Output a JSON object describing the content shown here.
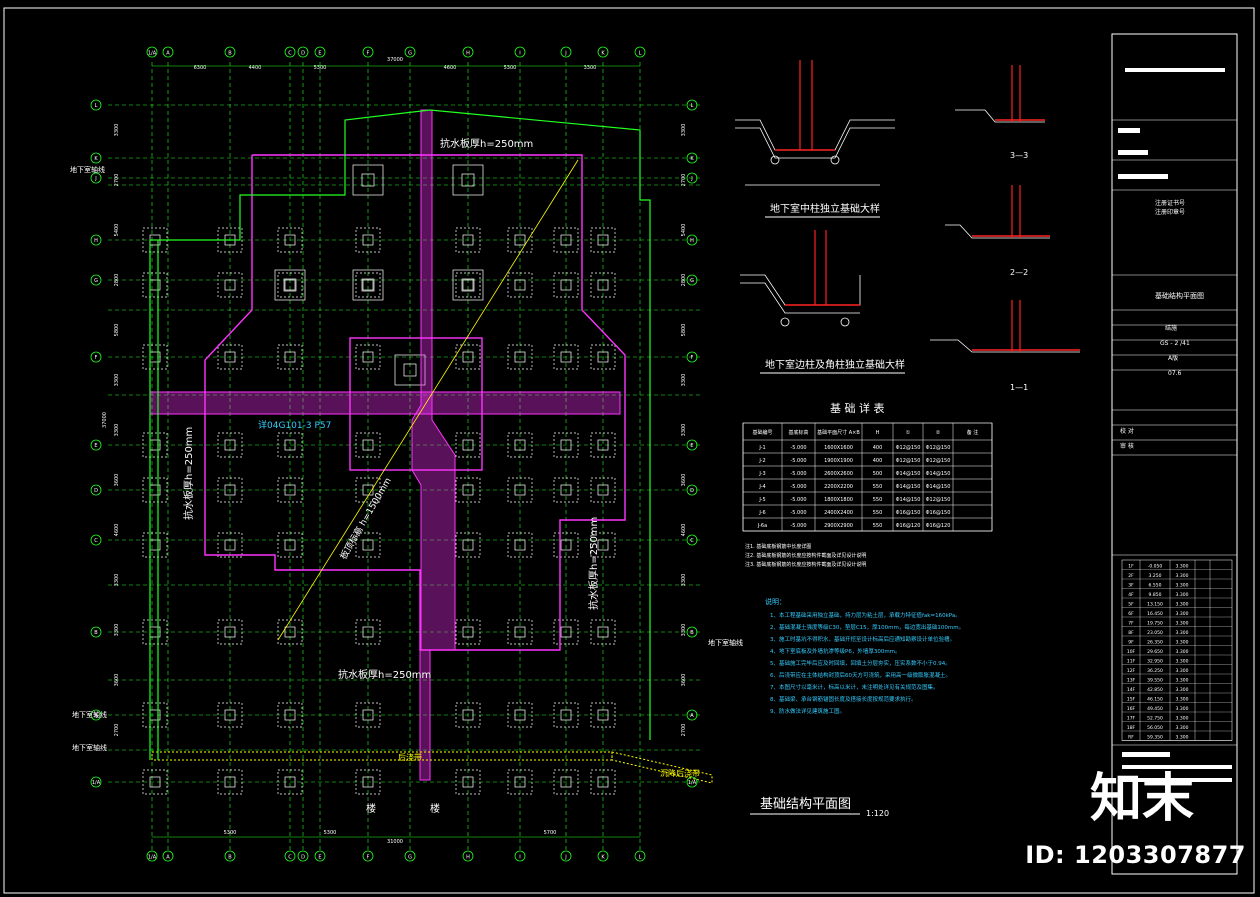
{
  "sheet": {
    "title": "基础结构平面图",
    "title_scale": "1:120"
  },
  "axes": {
    "top_labels": [
      "1/A",
      "A",
      "B",
      "C",
      "D",
      "E",
      "F",
      "G",
      "H",
      "I",
      "J",
      "K",
      "L"
    ],
    "left_labels": [
      "L",
      "K",
      "J",
      "H",
      "G",
      "F",
      "E",
      "D",
      "C",
      "B",
      "A",
      "1/A"
    ],
    "top_dims": [
      "6300",
      "4400",
      "5300",
      "4600",
      "5300",
      "3300"
    ],
    "top_total": "37000",
    "bottom_dims": [
      "5300",
      "5300",
      "5700"
    ],
    "bottom_total": "31000",
    "left_dims": [
      "3300",
      "2700",
      "5400",
      "2800",
      "5800",
      "3300",
      "3300",
      "3600",
      "4600",
      "3300",
      "3300",
      "3600",
      "2700"
    ],
    "left_total": "37000",
    "basement_labels": [
      "地下室轴线",
      "地下室轴线",
      "地下室轴线",
      "地下室轴线"
    ]
  },
  "annotations": {
    "slab1": "抗水板厚h=250mm",
    "slab2": "抗水板厚h=250mm",
    "slab3": "抗水板厚h=250mm",
    "slab4": "抗水板厚h=250mm",
    "ref": "详04G101-3 P57",
    "diag": "板顶标高 h=1500mm",
    "post_pour": "后浇带",
    "post_pour2": "沉降后浇带",
    "cut": "楼"
  },
  "details": {
    "title1": "地下室中柱独立基础大样",
    "title2": "地下室边柱及角柱独立基础大样",
    "sec1": "3—3",
    "sec2": "2—2",
    "sec3": "1—1"
  },
  "foundation_table": {
    "title": "基 础 详 表",
    "headers": [
      "基础编号",
      "基底标高",
      "基础平面尺寸 A×B",
      "H",
      "①",
      "②",
      "备 注"
    ],
    "rows": [
      [
        "J-1",
        "-5.000",
        "1600X1600",
        "400",
        "Φ12@150",
        "Φ12@150",
        ""
      ],
      [
        "J-2",
        "-5.000",
        "1900X1900",
        "400",
        "Φ12@150",
        "Φ12@150",
        ""
      ],
      [
        "J-3",
        "-5.000",
        "2600X2600",
        "500",
        "Φ14@150",
        "Φ14@150",
        ""
      ],
      [
        "J-4",
        "-5.000",
        "2200X2200",
        "550",
        "Φ14@150",
        "Φ14@150",
        ""
      ],
      [
        "J-5",
        "-5.000",
        "1800X1800",
        "550",
        "Φ14@150",
        "Φ12@150",
        ""
      ],
      [
        "J-6",
        "-5.000",
        "2400X2400",
        "550",
        "Φ16@150",
        "Φ16@150",
        ""
      ],
      [
        "J-6a",
        "-5.000",
        "2900X2900",
        "550",
        "Φ16@120",
        "Φ16@120",
        ""
      ]
    ],
    "notes": [
      "注1. 基础底板钢筋中长度详图",
      "注2. 基础底板钢筋的长度应按构件截面及详见设计说明",
      "注3. 基础底板钢筋的长度应按构件截面及详见设计说明"
    ]
  },
  "design_notes": {
    "heading": "说明：",
    "lines": [
      "1、本工程基础采用独立基础，持力层为粘土层，承载力特征值fak=160kPa。",
      "2、基础混凝土强度等级C30，垫层C15，厚100mm，每边宽出基础100mm。",
      "3、施工时基坑不得积水，基础开挖至设计标高后应通知勘察设计单位验槽。",
      "4、地下室底板及外墙抗渗等级P6，外墙厚300mm。",
      "5、基础施工完毕后应及时回填，回填土分层夯实，压实系数不小于0.94。",
      "6、后浇带应在主体结构封顶后60天方可浇筑，采用高一级微膨胀混凝土。",
      "7、本图尺寸以毫米计，标高以米计，未注明处详见有关规范及图集。",
      "8、基础梁、承台钢筋锚固长度及搭接长度按规范要求执行。",
      "9、防水做法详见建筑施工图。"
    ]
  },
  "title_block": {
    "project": "基础结构平面图",
    "design_org": "建设单位",
    "cert1": "注册证书号",
    "cert2": "注册印章号",
    "discipline": "结施",
    "sheet_no": "GS - 2 /41",
    "stage": "A版",
    "date": "07.6",
    "check": "校 对",
    "review": "审 核"
  },
  "floor_table": {
    "rows": [
      [
        "1F",
        "-0.050",
        "3.300"
      ],
      [
        "2F",
        "3.250",
        "3.300"
      ],
      [
        "3F",
        "6.550",
        "3.300"
      ],
      [
        "4F",
        "9.850",
        "3.300"
      ],
      [
        "5F",
        "13.150",
        "3.300"
      ],
      [
        "6F",
        "16.450",
        "3.300"
      ],
      [
        "7F",
        "19.750",
        "3.300"
      ],
      [
        "8F",
        "23.050",
        "3.300"
      ],
      [
        "9F",
        "26.350",
        "3.300"
      ],
      [
        "10F",
        "29.650",
        "3.300"
      ],
      [
        "11F",
        "32.950",
        "3.300"
      ],
      [
        "12F",
        "36.250",
        "3.300"
      ],
      [
        "13F",
        "39.550",
        "3.300"
      ],
      [
        "14F",
        "42.850",
        "3.300"
      ],
      [
        "15F",
        "46.150",
        "3.300"
      ],
      [
        "16F",
        "49.450",
        "3.300"
      ],
      [
        "17F",
        "52.750",
        "3.300"
      ],
      [
        "18F",
        "56.050",
        "3.300"
      ],
      [
        "RF",
        "59.350",
        "3.300"
      ]
    ]
  },
  "watermark": {
    "logo": "知末",
    "id": "ID: 1203307877"
  },
  "colors": {
    "background": "#000000",
    "grid": "#22ff22",
    "slab": "#ff33ff",
    "text": "#ffffff",
    "rebar": "#ff2222",
    "highlight": "#ffff00",
    "cyan": "#33ccff"
  }
}
